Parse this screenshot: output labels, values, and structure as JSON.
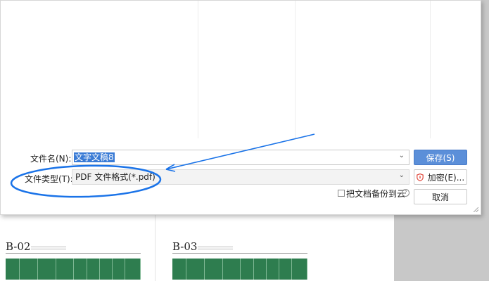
{
  "dialog": {
    "filename_label": "文件名(N):",
    "filename_value": "文字文稿8",
    "filetype_label": "文件类型(T):",
    "filetype_value": "PDF 文件格式(*.pdf)",
    "save_label": "保存(S)",
    "encrypt_label": "加密(E)...",
    "cancel_label": "取消",
    "backup_label": "把文档备份到云",
    "help_glyph": "?"
  },
  "background_doc": {
    "pages": [
      {
        "code": "B-02"
      },
      {
        "code": "B-03"
      }
    ]
  },
  "icons": {
    "dropdown": "chevron-down-icon",
    "encrypt": "shield-icon",
    "help": "help-circle-icon"
  },
  "colors": {
    "annotation": "#1a73e8",
    "primary_button": "#5b8fd9",
    "selection": "#3a7bd5",
    "table_green": "#2e7d4f",
    "shield_red": "#e0463a"
  }
}
